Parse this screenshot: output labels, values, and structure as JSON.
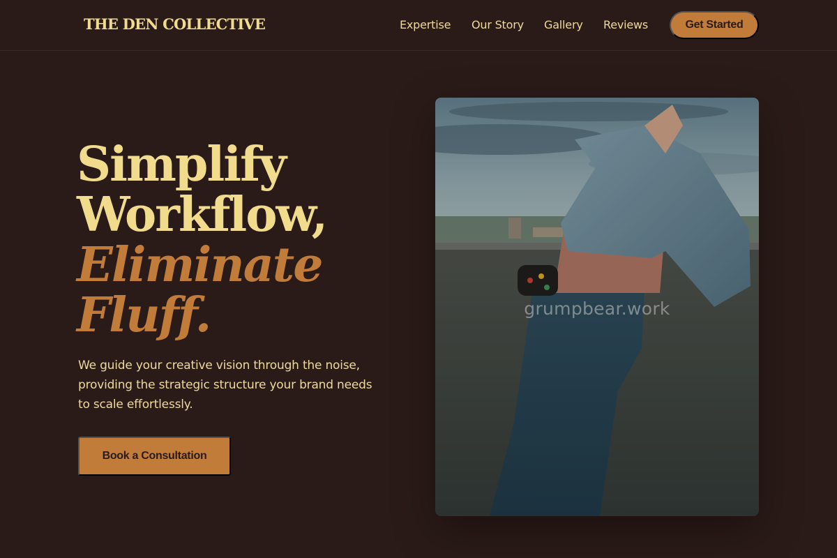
{
  "brand": {
    "logo_text": "THE DEN COLLECTIVE"
  },
  "nav": {
    "links": [
      "Expertise",
      "Our Story",
      "Gallery",
      "Reviews"
    ],
    "cta_label": "Get Started"
  },
  "hero": {
    "title_line_1": "Simplify",
    "title_line_2": "Workflow,",
    "title_line_3": "Eliminate",
    "title_line_4": "Fluff.",
    "description": "We guide your creative vision through the noise, providing the strategic structure your brand needs to scale effortlessly.",
    "button_label": "Book a Consultation"
  },
  "image": {
    "watermark": "grumpbear.work"
  },
  "colors": {
    "background": "#2a1b18",
    "heading_cream": "#f0dc8c",
    "accent_copper": "#c27c39",
    "text_cream": "#eed9a0"
  }
}
